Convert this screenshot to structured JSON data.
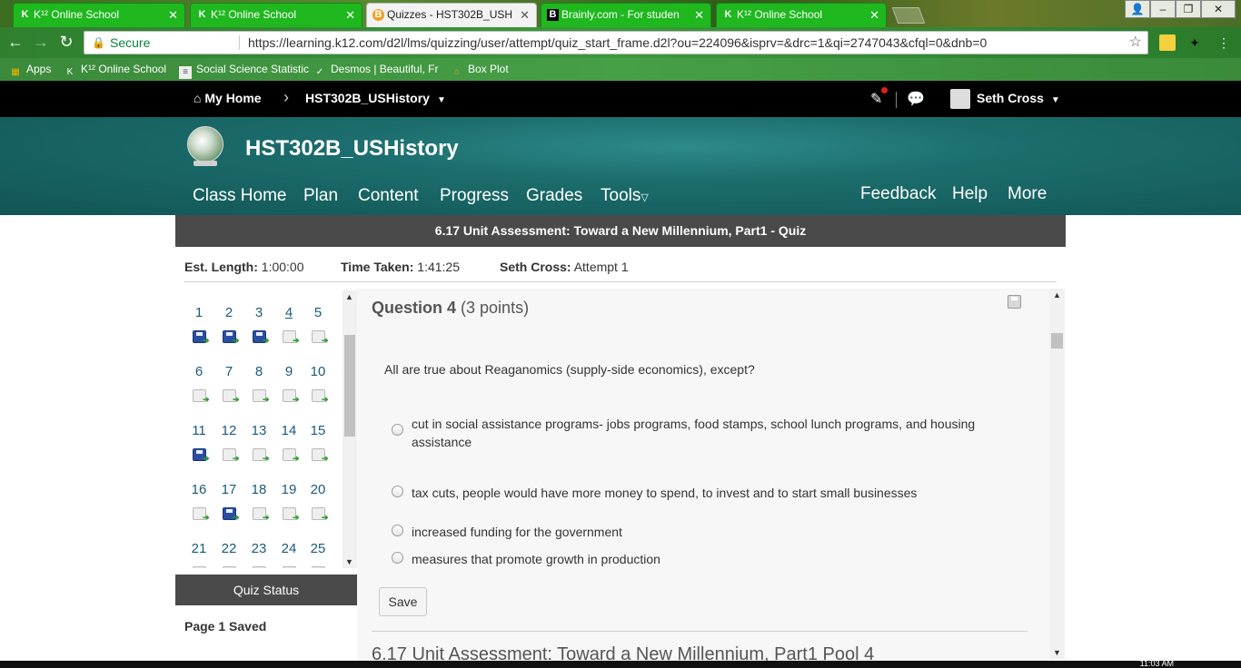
{
  "browser": {
    "tabs": [
      {
        "title": "K¹² Online School",
        "active": false
      },
      {
        "title": "K¹² Online School",
        "active": false
      },
      {
        "title": "Quizzes - HST302B_USH",
        "active": true
      },
      {
        "title": "Brainly.com - For studen",
        "active": false
      },
      {
        "title": "K¹² Online School",
        "active": false
      }
    ],
    "secure_label": "Secure",
    "url": "https://learning.k12.com/d2l/lms/quizzing/user/attempt/quiz_start_frame.d2l?ou=224096&isprv=&drc=1&qi=2747043&cfql=0&dnb=0",
    "bookmarks": [
      "Apps",
      "K¹² Online School",
      "Social Science Statistic",
      "Desmos | Beautiful, Fr",
      "Box Plot"
    ],
    "clock": "11:03 AM"
  },
  "topnav": {
    "home": "My Home",
    "course": "HST302B_USHistory",
    "user": "Seth Cross"
  },
  "banner": {
    "course_title": "HST302B_USHistory",
    "nav_left": [
      "Class Home",
      "Plan",
      "Content",
      "Progress",
      "Grades",
      "Tools"
    ],
    "nav_right": [
      "Feedback",
      "Help",
      "More"
    ]
  },
  "quiz": {
    "title": "6.17 Unit Assessment: Toward a New Millennium, Part1 - Quiz",
    "est_length_label": "Est. Length:",
    "est_length": "1:00:00",
    "time_taken_label": "Time Taken:",
    "time_taken": "1:41:25",
    "attempt_user": "Seth Cross:",
    "attempt": "Attempt 1",
    "status_button": "Quiz Status",
    "page_saved": "Page 1 Saved",
    "questions": [
      {
        "n": "1",
        "saved": true
      },
      {
        "n": "2",
        "saved": true
      },
      {
        "n": "3",
        "saved": true
      },
      {
        "n": "4",
        "saved": false
      },
      {
        "n": "5",
        "saved": false
      },
      {
        "n": "6",
        "saved": false
      },
      {
        "n": "7",
        "saved": false
      },
      {
        "n": "8",
        "saved": false
      },
      {
        "n": "9",
        "saved": false
      },
      {
        "n": "10",
        "saved": false
      },
      {
        "n": "11",
        "saved": true
      },
      {
        "n": "12",
        "saved": false
      },
      {
        "n": "13",
        "saved": false
      },
      {
        "n": "14",
        "saved": false
      },
      {
        "n": "15",
        "saved": false
      },
      {
        "n": "16",
        "saved": false
      },
      {
        "n": "17",
        "saved": true
      },
      {
        "n": "18",
        "saved": false
      },
      {
        "n": "19",
        "saved": false
      },
      {
        "n": "20",
        "saved": false
      },
      {
        "n": "21",
        "saved": false
      },
      {
        "n": "22",
        "saved": false
      },
      {
        "n": "23",
        "saved": false
      },
      {
        "n": "24",
        "saved": false
      },
      {
        "n": "25",
        "saved": false
      }
    ],
    "current_question": "4"
  },
  "question": {
    "label": "Question 4",
    "points": "(3 points)",
    "text": "All are true about Reaganomics (supply-side economics), except?",
    "options": [
      "cut in social assistance programs- jobs programs, food stamps, school lunch programs, and housing assistance",
      "tax cuts, people would have more money to spend, to invest and to start small businesses",
      "increased funding for the government",
      "measures that promote growth in production"
    ],
    "save_label": "Save",
    "next_section": "6.17 Unit Assessment: Toward a New Millennium, Part1 Pool 4"
  }
}
